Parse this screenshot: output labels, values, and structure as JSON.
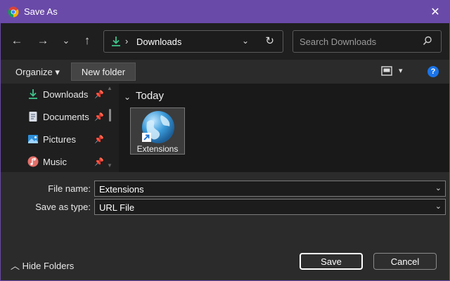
{
  "window": {
    "title": "Save As",
    "close_glyph": "✕",
    "title_bar_color": "#6a4aa8"
  },
  "nav": {
    "back_glyph": "←",
    "forward_glyph": "→",
    "recent_glyph": "⌄",
    "up_glyph": "↑",
    "path_separator": "›",
    "current_folder": "Downloads",
    "dropdown_glyph": "⌄",
    "refresh_glyph": "↻",
    "search_placeholder": "Search Downloads"
  },
  "toolbar": {
    "organize_label": "Organize ▾",
    "new_folder_label": "New folder",
    "view_dropdown_glyph": "▾",
    "help_glyph": "?"
  },
  "sidebar": {
    "items": [
      {
        "label": "Downloads",
        "icon": "download-icon",
        "pinned": true
      },
      {
        "label": "Documents",
        "icon": "documents-icon",
        "pinned": true
      },
      {
        "label": "Pictures",
        "icon": "pictures-icon",
        "pinned": true
      },
      {
        "label": "Music",
        "icon": "music-icon",
        "pinned": true
      }
    ],
    "pin_glyph": "📌"
  },
  "content": {
    "group_chevron": "⌄",
    "group_label": "Today",
    "files": [
      {
        "name": "Extensions",
        "icon": "url-shortcut-icon",
        "selected": true
      }
    ]
  },
  "form": {
    "filename_label": "File name:",
    "filename_value": "Extensions",
    "savetype_label": "Save as type:",
    "savetype_value": "URL File",
    "dropdown_glyph": "⌄"
  },
  "footer": {
    "hide_folders_label": "︿  Hide Folders",
    "save_label": "Save",
    "cancel_label": "Cancel"
  },
  "colors": {
    "accent": "#6a4aa8",
    "download_green": "#3fc28a",
    "help_blue": "#1a73e8"
  }
}
